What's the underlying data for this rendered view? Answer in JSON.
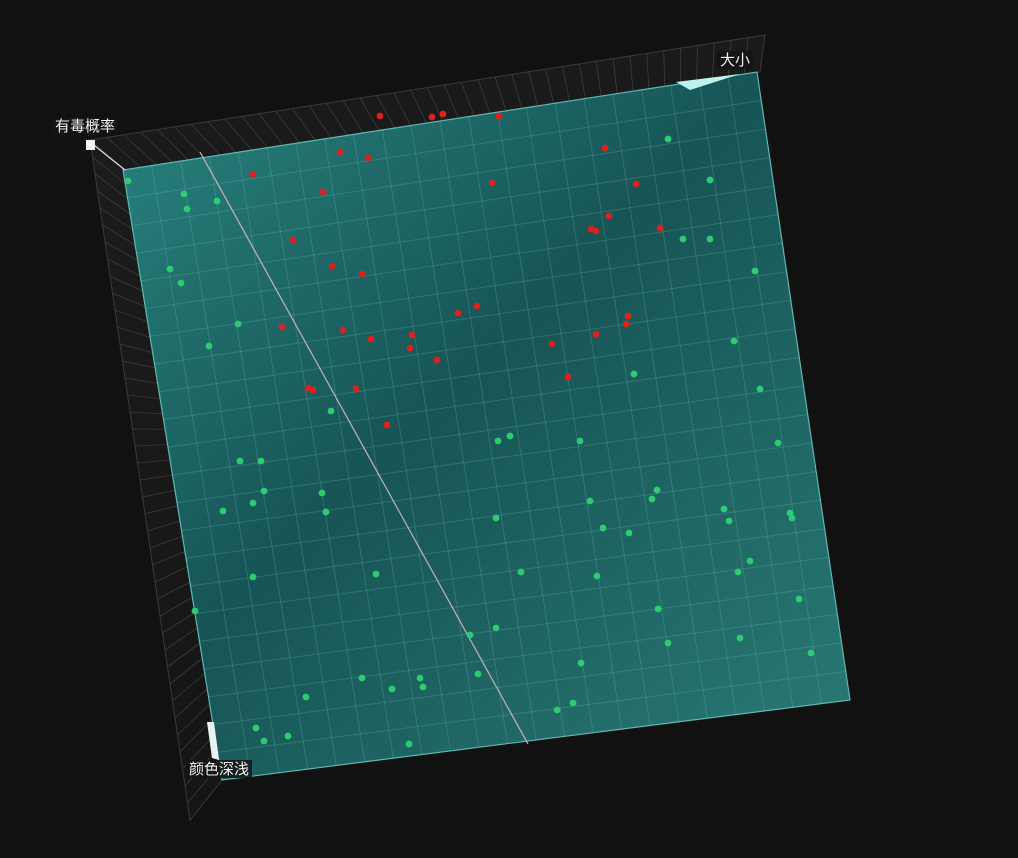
{
  "chart_data": {
    "type": "scatter",
    "title": "",
    "axes": {
      "x_label": "颜色深浅",
      "y_label": "大小",
      "z_label": "有毒概率"
    },
    "series": [
      {
        "color": "#e02020",
        "points": [
          [
            380,
            116
          ],
          [
            432,
            117
          ],
          [
            443,
            114
          ],
          [
            499,
            116
          ],
          [
            340,
            152
          ],
          [
            368,
            158
          ],
          [
            253,
            174
          ],
          [
            323,
            192
          ],
          [
            492,
            183
          ],
          [
            605,
            148
          ],
          [
            636,
            184
          ],
          [
            609,
            216
          ],
          [
            591,
            229
          ],
          [
            596,
            231
          ],
          [
            660,
            228
          ],
          [
            293,
            240
          ],
          [
            332,
            266
          ],
          [
            362,
            274
          ],
          [
            458,
            313
          ],
          [
            477,
            306
          ],
          [
            282,
            327
          ],
          [
            343,
            330
          ],
          [
            371,
            339
          ],
          [
            412,
            335
          ],
          [
            410,
            348
          ],
          [
            437,
            360
          ],
          [
            628,
            316
          ],
          [
            626,
            324
          ],
          [
            596,
            334
          ],
          [
            552,
            344
          ],
          [
            568,
            377
          ],
          [
            308,
            388
          ],
          [
            313,
            390
          ],
          [
            356,
            389
          ],
          [
            387,
            425
          ]
        ]
      },
      {
        "color": "#2ecc71",
        "points": [
          [
            128,
            181
          ],
          [
            184,
            194
          ],
          [
            187,
            209
          ],
          [
            217,
            201
          ],
          [
            668,
            139
          ],
          [
            710,
            180
          ],
          [
            683,
            239
          ],
          [
            710,
            239
          ],
          [
            755,
            271
          ],
          [
            170,
            269
          ],
          [
            181,
            283
          ],
          [
            238,
            324
          ],
          [
            209,
            346
          ],
          [
            734,
            341
          ],
          [
            634,
            374
          ],
          [
            760,
            389
          ],
          [
            331,
            411
          ],
          [
            498,
            441
          ],
          [
            510,
            436
          ],
          [
            580,
            441
          ],
          [
            778,
            443
          ],
          [
            240,
            461
          ],
          [
            261,
            461
          ],
          [
            264,
            491
          ],
          [
            253,
            503
          ],
          [
            322,
            493
          ],
          [
            326,
            512
          ],
          [
            223,
            511
          ],
          [
            496,
            518
          ],
          [
            590,
            501
          ],
          [
            603,
            528
          ],
          [
            629,
            533
          ],
          [
            657,
            490
          ],
          [
            652,
            499
          ],
          [
            724,
            509
          ],
          [
            729,
            521
          ],
          [
            790,
            513
          ],
          [
            792,
            518
          ],
          [
            750,
            561
          ],
          [
            738,
            572
          ],
          [
            521,
            572
          ],
          [
            597,
            576
          ],
          [
            376,
            574
          ],
          [
            253,
            577
          ],
          [
            195,
            611
          ],
          [
            799,
            599
          ],
          [
            658,
            609
          ],
          [
            496,
            628
          ],
          [
            470,
            635
          ],
          [
            668,
            643
          ],
          [
            740,
            638
          ],
          [
            811,
            653
          ],
          [
            362,
            678
          ],
          [
            392,
            689
          ],
          [
            420,
            678
          ],
          [
            423,
            687
          ],
          [
            478,
            674
          ],
          [
            581,
            663
          ],
          [
            306,
            697
          ],
          [
            573,
            703
          ],
          [
            557,
            710
          ],
          [
            256,
            728
          ],
          [
            264,
            741
          ],
          [
            288,
            736
          ],
          [
            409,
            744
          ]
        ]
      }
    ]
  }
}
